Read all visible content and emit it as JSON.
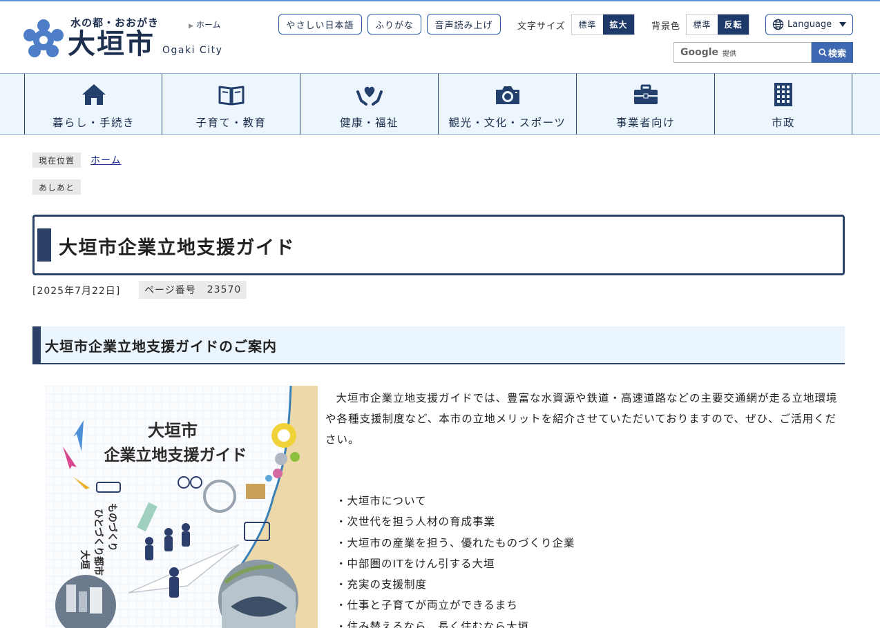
{
  "header": {
    "tagline": "水の都・おおがき",
    "city_name": "大垣市",
    "city_name_en": "Ogaki City",
    "home_link": "ホーム",
    "buttons": {
      "easy_japanese": "やさしい日本語",
      "furigana": "ふりがな",
      "read_aloud": "音声読み上げ"
    },
    "font_size": {
      "label": "文字サイズ",
      "standard": "標準",
      "large": "拡大"
    },
    "bg_color": {
      "label": "背景色",
      "standard": "標準",
      "invert": "反転"
    },
    "language": "Language",
    "search": {
      "provider": "Google",
      "provided": "提供",
      "button": "検索"
    }
  },
  "nav": [
    {
      "label": "暮らし・手続き",
      "icon": "house-icon"
    },
    {
      "label": "子育て・教育",
      "icon": "book-icon"
    },
    {
      "label": "健康・福祉",
      "icon": "hands-heart-icon"
    },
    {
      "label": "観光・文化・スポーツ",
      "icon": "camera-icon"
    },
    {
      "label": "事業者向け",
      "icon": "briefcase-icon"
    },
    {
      "label": "市政",
      "icon": "building-icon"
    }
  ],
  "breadcrumb": {
    "current_label": "現在位置",
    "home": "ホーム",
    "footprints": "あしあと"
  },
  "page": {
    "title": "大垣市企業立地支援ガイド",
    "date": "[2025年7月22日]",
    "page_number_label": "ページ番号",
    "page_number": "23570",
    "section_heading": "大垣市企業立地支援ガイドのご案内",
    "intro": "大垣市企業立地支援ガイドでは、豊富な水資源や鉄道・高速道路などの主要交通網が走る立地環境や各種支援制度など、本市の立地メリットを紹介させていただいておりますので、ぜひ、ご活用ください。",
    "items": [
      "・大垣市について",
      "・次世代を担う人材の育成事業",
      "・大垣市の産業を担う、優れたものづくり企業",
      "・中部圏のITをけん引する大垣",
      "・充実の支援制度",
      "・仕事と子育てが両立ができるまち",
      "・住み替えるなら、長く住むなら大垣"
    ]
  },
  "guide_image": {
    "title_line1": "大垣市",
    "title_line2": "企業立地支援ガイド",
    "side_line1": "ものづくり",
    "side_line2": "ひとづくり都市",
    "side_line3": "大垣"
  },
  "colors": {
    "navy": "#2b4168",
    "accent_blue": "#3f68b3",
    "nav_bg": "#eef6fd"
  }
}
